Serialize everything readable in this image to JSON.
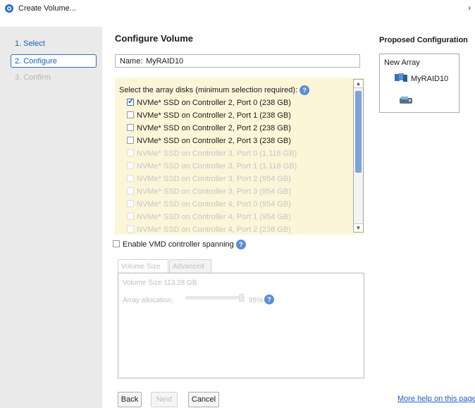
{
  "window": {
    "title": "Create Volume...",
    "close_glyph": "›"
  },
  "steps": [
    {
      "label": "1. Select",
      "state": "done"
    },
    {
      "label": "2. Configure",
      "state": "active"
    },
    {
      "label": "3. Confirm",
      "state": "disabled"
    }
  ],
  "main": {
    "heading": "Configure Volume",
    "name_label": "Name:",
    "name_value": "MyRAID10",
    "disks_prompt": "Select the array disks (minimum selection required):",
    "help_glyph": "?",
    "disks": [
      {
        "label": "NVMe* SSD on Controller 2, Port 0 (238 GB)",
        "checked": true,
        "enabled": true
      },
      {
        "label": "NVMe* SSD on Controller 2, Port 1 (238 GB)",
        "checked": false,
        "enabled": true
      },
      {
        "label": "NVMe* SSD on Controller 2, Port 2 (238 GB)",
        "checked": false,
        "enabled": true
      },
      {
        "label": "NVMe* SSD on Controller 2, Port 3 (238 GB)",
        "checked": false,
        "enabled": true
      },
      {
        "label": "NVMe* SSD on Controller 3, Port 0 (1,118 GB)",
        "checked": false,
        "enabled": false
      },
      {
        "label": "NVMe* SSD on Controller 3, Port 1 (1,118 GB)",
        "checked": false,
        "enabled": false
      },
      {
        "label": "NVMe* SSD on Controller 3, Port 2 (954 GB)",
        "checked": false,
        "enabled": false
      },
      {
        "label": "NVMe* SSD on Controller 3, Port 3 (954 GB)",
        "checked": false,
        "enabled": false
      },
      {
        "label": "NVMe* SSD on Controller 4, Port 0 (954 GB)",
        "checked": false,
        "enabled": false
      },
      {
        "label": "NVMe* SSD on Controller 4, Port 1 (954 GB)",
        "checked": false,
        "enabled": false
      },
      {
        "label": "NVMe* SSD on Controller 4, Port 2 (238 GB)",
        "checked": false,
        "enabled": false
      }
    ],
    "vmd_label": "Enable VMD controller spanning",
    "tabs": [
      {
        "label": "Volume Size",
        "selected": true
      },
      {
        "label": "Advanced",
        "selected": false
      }
    ],
    "volume_size": "Volume Size 113.28 GB",
    "allocation_label": "Array allocation:",
    "allocation_value": "95%",
    "allocation_fraction": 0.95
  },
  "buttons": {
    "back": "Back",
    "next": "Next",
    "cancel": "Cancel",
    "help_link": "More help on this page"
  },
  "proposed": {
    "heading": "Proposed Configuration",
    "array_title": "New Array",
    "volume_name": "MyRAID10"
  },
  "colors": {
    "accent": "#2a6ebd",
    "disk_list_bg": "#fbf6d8",
    "sidebar_bg": "#eaeaea"
  }
}
